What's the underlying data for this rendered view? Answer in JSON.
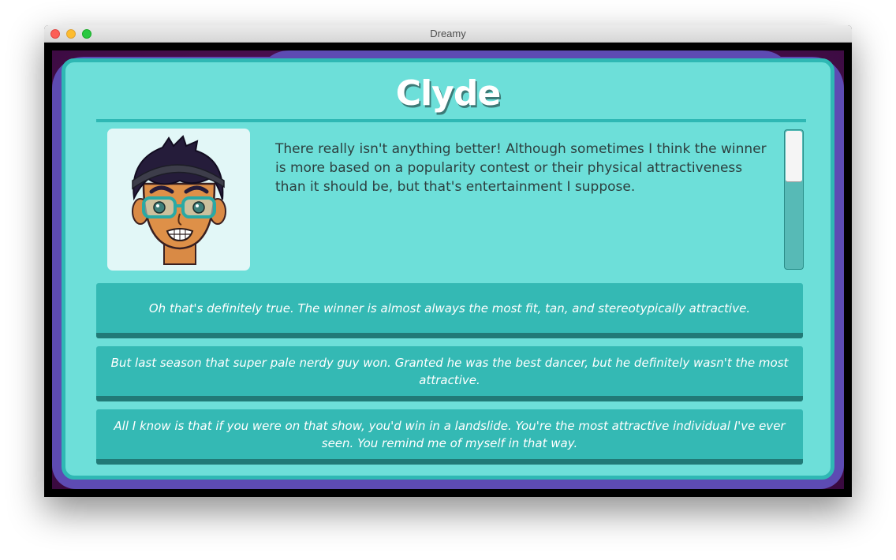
{
  "window": {
    "title": "Dreamy"
  },
  "character": {
    "name": "Clyde",
    "portrait_icon": "clyde-portrait"
  },
  "dialogue": {
    "text": "There really isn't anything better! Although sometimes I think the winner is more based on a popularity contest or their physical attractiveness than it should be, but that's entertainment I suppose."
  },
  "choices": [
    {
      "label": "Oh that's definitely true. The winner is almost always the most fit, tan, and stereotypically attractive."
    },
    {
      "label": "But last season that super pale nerdy guy won. Granted he was the best dancer, but he definitely wasn't the most attractive."
    },
    {
      "label": "All I know is that if you were on that show, you'd win in a landslide. You're the most attractive individual I've ever seen. You remind me of myself in that way."
    }
  ],
  "colors": {
    "panel": "#6ddfd9",
    "panel_border": "#2fb8b4",
    "choice_bg": "#34b9b4",
    "frame_purple": "#5d4bb3"
  }
}
